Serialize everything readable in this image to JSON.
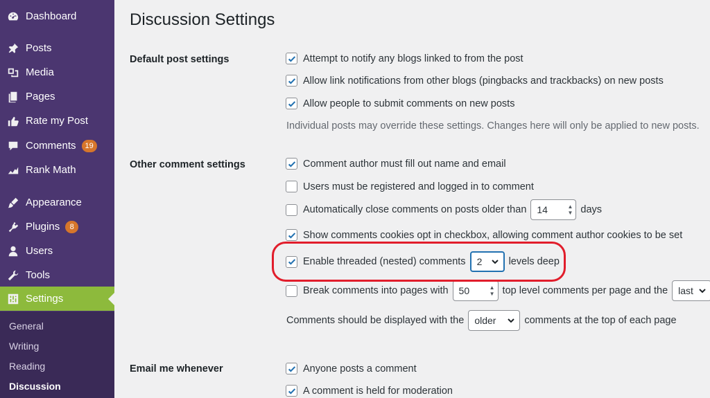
{
  "sidebar": {
    "items": [
      {
        "label": "Dashboard",
        "icon": "dashboard-icon"
      },
      {
        "label": "Posts",
        "icon": "pin-icon"
      },
      {
        "label": "Media",
        "icon": "media-icon"
      },
      {
        "label": "Pages",
        "icon": "pages-icon"
      },
      {
        "label": "Rate my Post",
        "icon": "thumbs-up-icon"
      },
      {
        "label": "Comments",
        "icon": "comment-icon",
        "badge": "19"
      },
      {
        "label": "Rank Math",
        "icon": "rank-math-icon"
      },
      {
        "label": "Appearance",
        "icon": "brush-icon"
      },
      {
        "label": "Plugins",
        "icon": "plug-icon",
        "badge": "8"
      },
      {
        "label": "Users",
        "icon": "user-icon"
      },
      {
        "label": "Tools",
        "icon": "wrench-icon"
      },
      {
        "label": "Settings",
        "icon": "settings-icon",
        "active": true
      }
    ],
    "submenu": [
      "General",
      "Writing",
      "Reading",
      "Discussion"
    ],
    "colors": {
      "bg": "#4b3670",
      "active": "#8dba3c",
      "badge": "#d6762b"
    }
  },
  "page": {
    "title": "Discussion Settings"
  },
  "default_post": {
    "label": "Default post settings",
    "opt1": "Attempt to notify any blogs linked to from the post",
    "opt2": "Allow link notifications from other blogs (pingbacks and trackbacks) on new posts",
    "opt3": "Allow people to submit comments on new posts",
    "note": "Individual posts may override these settings. Changes here will only be applied to new posts."
  },
  "other_comment": {
    "label": "Other comment settings",
    "author_fill": "Comment author must fill out name and email",
    "registered": "Users must be registered and logged in to comment",
    "close_before": "Automatically close comments on posts older than",
    "close_days": "14",
    "close_after": "days",
    "cookies": "Show comments cookies opt in checkbox, allowing comment author cookies to be set",
    "threaded_before": "Enable threaded (nested) comments",
    "threaded_depth": "2",
    "threaded_after": "levels deep",
    "pages_before": "Break comments into pages with",
    "pages_count": "50",
    "pages_middle": "top level comments per page and the",
    "pages_select": "last",
    "display_before": "Comments should be displayed with the",
    "display_select": "older",
    "display_after": "comments at the top of each page"
  },
  "email": {
    "label": "Email me whenever",
    "opt1": "Anyone posts a comment",
    "opt2": "A comment is held for moderation"
  },
  "colors": {
    "highlight": "#e11d2b",
    "check": "#2271b1"
  }
}
